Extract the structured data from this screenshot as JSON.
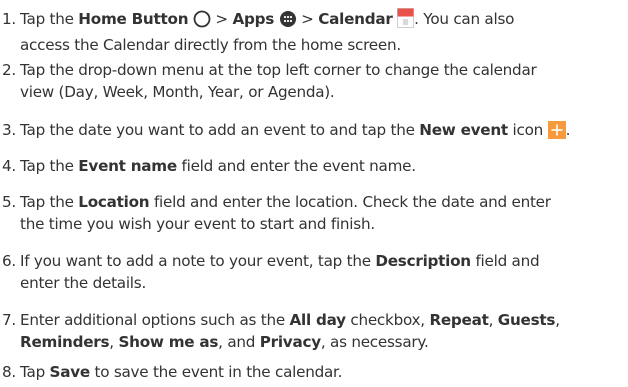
{
  "steps": [
    {
      "number": "1.",
      "line1": {
        "t1": "Tap the ",
        "kw1": "Home Button",
        "t2": " > ",
        "kw2": "Apps",
        "t3": " > ",
        "kw3": "Calendar",
        "t4": ". You can also"
      },
      "line2": "access the Calendar directly from the home screen.",
      "icons": [
        "home-circle-icon",
        "apps-grid-icon",
        "calendar-app-icon"
      ]
    },
    {
      "number": "2.",
      "line1": "Tap the drop-down menu at the top left corner to change the calendar",
      "line2": "view (Day, Week, Month, Year, or Agenda)."
    },
    {
      "number": "3.",
      "t1": "Tap the date you want to add an event to and tap the ",
      "kw1": "New event",
      "t2": " icon ",
      "t3": ".",
      "icons": [
        "plus-icon"
      ]
    },
    {
      "number": "4.",
      "t1": "Tap the ",
      "kw1": "Event name",
      "t2": " field and enter the event name."
    },
    {
      "number": "5.",
      "t1": "Tap the ",
      "kw1": "Location",
      "t2": " field and enter the location. Check the date and enter",
      "line2": "the time you wish your event to start and finish."
    },
    {
      "number": "6.",
      "t1": "If you want to add a note to your event, tap the ",
      "kw1": "Description",
      "t2": " field and",
      "line2": "enter the details."
    },
    {
      "number": "7.",
      "t1": "Enter additional options such as the ",
      "kw1": "All day",
      "t2": " checkbox, ",
      "kw2": "Repeat",
      "t3": ", ",
      "kw3": "Guests",
      "t4": ",",
      "l2kw1": "Reminders",
      "l2t1": ", ",
      "l2kw2": "Show me as",
      "l2t2": ", and ",
      "l2kw3": "Privacy",
      "l2t3": ", as necessary."
    },
    {
      "number": "8.",
      "t1": "Tap ",
      "kw1": "Save",
      "t2": " to save the event in the calendar."
    }
  ],
  "colors": {
    "text": "#333333",
    "plus_icon_bg": "#f79a3b",
    "calendar_icon_top": "#e8524a"
  }
}
